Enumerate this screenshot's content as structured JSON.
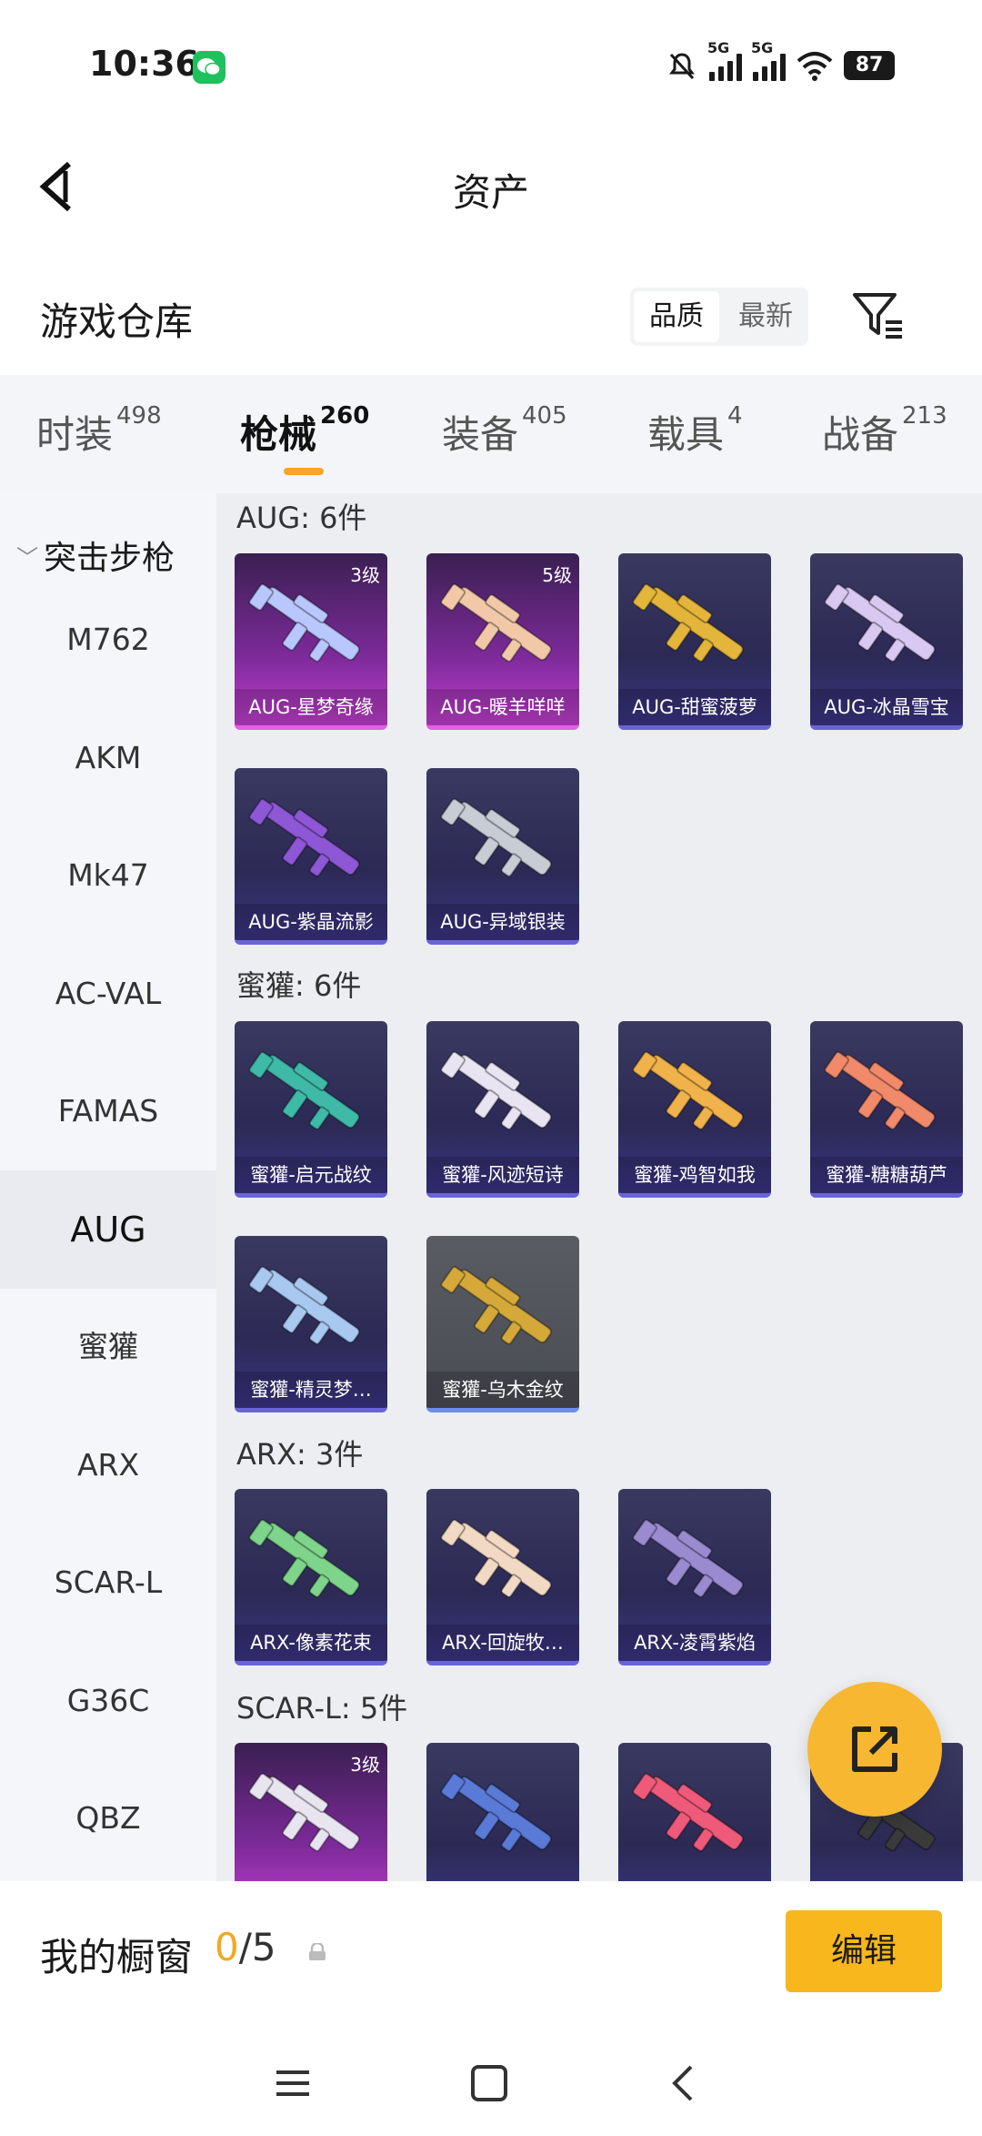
{
  "status": {
    "time": "10:36",
    "battery": "87",
    "net1": "5G",
    "net2": "5G"
  },
  "header": {
    "title": "资产"
  },
  "warehouse": {
    "title": "游戏仓库",
    "sort": [
      "品质",
      "最新"
    ]
  },
  "tabs": [
    {
      "label": "时装",
      "count": "498"
    },
    {
      "label": "枪械",
      "count": "260"
    },
    {
      "label": "装备",
      "count": "405"
    },
    {
      "label": "载具",
      "count": "4"
    },
    {
      "label": "战备",
      "count": "213"
    }
  ],
  "sidebar": {
    "category": "突击步枪",
    "items": [
      "M762",
      "AKM",
      "Mk47",
      "AC-VAL",
      "FAMAS",
      "AUG",
      "蜜獾",
      "ARX",
      "SCAR-L",
      "G36C",
      "QBZ"
    ]
  },
  "groups": [
    {
      "label": "AUG: 6件",
      "items": [
        {
          "name": "AUG-星梦奇缘",
          "level": "3级",
          "color": "#b9c7ff"
        },
        {
          "name": "AUG-暖羊咩咩",
          "level": "5级",
          "color": "#f2c9a8"
        },
        {
          "name": "AUG-甜蜜菠萝",
          "level": "",
          "color": "#e3b53a"
        },
        {
          "name": "AUG-冰晶雪宝",
          "level": "",
          "color": "#d9c8f2"
        },
        {
          "name": "AUG-紫晶流影",
          "level": "",
          "color": "#8e57d6"
        },
        {
          "name": "AUG-异域银装",
          "level": "",
          "color": "#c8ccd4"
        }
      ]
    },
    {
      "label": "蜜獾: 6件",
      "items": [
        {
          "name": "蜜獾-启元战纹",
          "level": "",
          "color": "#3fb9a8"
        },
        {
          "name": "蜜獾-风迹短诗",
          "level": "",
          "color": "#e8e4f2"
        },
        {
          "name": "蜜獾-鸡智如我",
          "level": "",
          "color": "#f0b24a"
        },
        {
          "name": "蜜獾-糖糖葫芦",
          "level": "",
          "color": "#f08a6a"
        },
        {
          "name": "蜜獾-精灵梦…",
          "level": "",
          "color": "#a8c8f0"
        },
        {
          "name": "蜜獾-乌木金纹",
          "level": "",
          "color": "#d4a93a"
        }
      ]
    },
    {
      "label": "ARX: 3件",
      "items": [
        {
          "name": "ARX-像素花束",
          "level": "",
          "color": "#7ed48a"
        },
        {
          "name": "ARX-回旋牧…",
          "level": "",
          "color": "#f2d9c4"
        },
        {
          "name": "ARX-凌霄紫焰",
          "level": "",
          "color": "#9a8ad0"
        }
      ]
    },
    {
      "label": "SCAR-L: 5件",
      "items": [
        {
          "name": "",
          "level": "3级",
          "color": "#e8e4f0"
        },
        {
          "name": "",
          "level": "",
          "color": "#5a7ad8"
        },
        {
          "name": "",
          "level": "",
          "color": "#f05a7a"
        },
        {
          "name": "",
          "level": "",
          "color": "#3a3a3a"
        }
      ]
    }
  ],
  "showcase": {
    "title": "我的橱窗",
    "current": "0",
    "total": "/5",
    "edit": "编辑"
  }
}
